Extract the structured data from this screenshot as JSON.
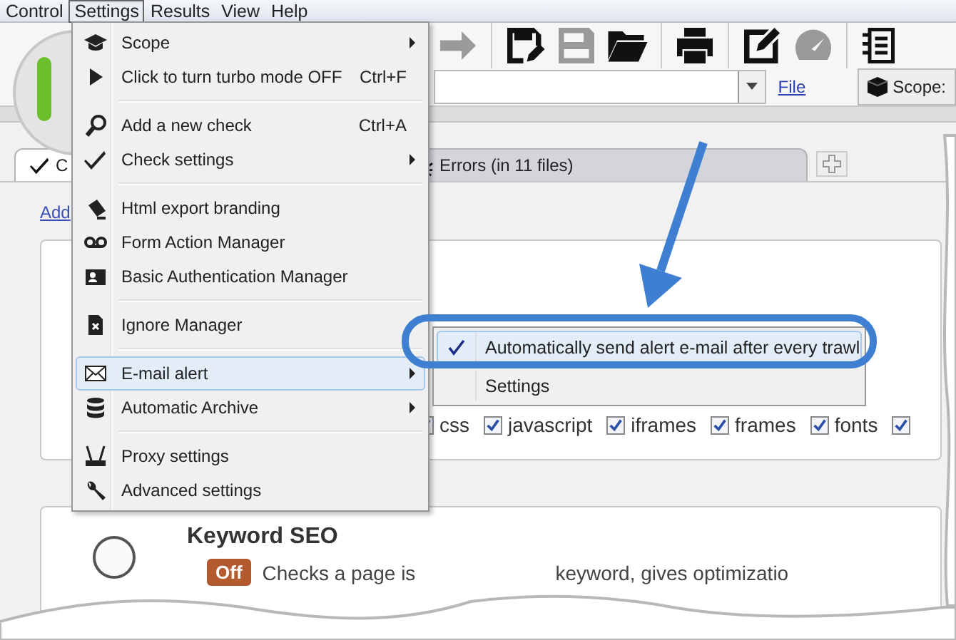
{
  "menu_bar": [
    {
      "label": "Control",
      "selected": false
    },
    {
      "label": "Settings",
      "selected": true
    },
    {
      "label": "Results",
      "selected": false
    },
    {
      "label": "View",
      "selected": false
    },
    {
      "label": "Help",
      "selected": false
    }
  ],
  "toolbar": [
    {
      "kind": "forward",
      "disabled": true
    },
    {
      "kind": "save-edit",
      "disabled": false
    },
    {
      "kind": "save",
      "disabled": true
    },
    {
      "kind": "open",
      "disabled": false
    },
    {
      "kind": "print",
      "disabled": false
    },
    {
      "kind": "edit",
      "disabled": false
    },
    {
      "kind": "gauge",
      "disabled": true
    },
    {
      "kind": "notes",
      "disabled": false
    }
  ],
  "address": {
    "link": "File",
    "scope": "Scope:"
  },
  "tabs": [
    {
      "kind": "check",
      "label": "C",
      "selected": true
    },
    {
      "kind": "errors",
      "label": "Errors (in 11 files)",
      "selected": false
    }
  ],
  "add_link": "Add",
  "filters": [
    {
      "label": "css",
      "checked": true
    },
    {
      "label": "javascript",
      "checked": true
    },
    {
      "label": "iframes",
      "checked": true
    },
    {
      "label": "frames",
      "checked": true
    },
    {
      "label": "fonts",
      "checked": true
    },
    {
      "checked": true
    }
  ],
  "cards": [
    {
      "title": "Keyword SEO",
      "selected": false,
      "badge": "Off",
      "description": [
        "Checks a page is",
        "keyword, gives optimizatio"
      ]
    }
  ],
  "settings_menu": {
    "groups": [
      {
        "items": [
          {
            "label": "Scope",
            "submenu": true,
            "selected": false
          },
          {
            "label": "Click to turn turbo mode OFF",
            "shortcut": "Ctrl+F",
            "submenu": false,
            "selected": false
          }
        ]
      },
      {
        "items": [
          {
            "label": "Add a new check",
            "shortcut": "Ctrl+A",
            "submenu": false,
            "selected": false
          },
          {
            "label": "Check settings",
            "submenu": true,
            "selected": false
          }
        ]
      },
      {
        "items": [
          {
            "label": "Html export branding",
            "submenu": false,
            "selected": false
          },
          {
            "label": "Form Action Manager",
            "submenu": false,
            "selected": false
          },
          {
            "label": "Basic Authentication Manager",
            "submenu": false,
            "selected": false
          }
        ]
      },
      {
        "items": [
          {
            "label": "Ignore Manager",
            "submenu": false,
            "selected": false
          }
        ]
      },
      {
        "items": [
          {
            "label": "E-mail alert",
            "submenu": true,
            "selected": true
          },
          {
            "label": "Automatic Archive",
            "submenu": true,
            "selected": false
          }
        ]
      },
      {
        "items": [
          {
            "label": "Proxy settings",
            "submenu": false,
            "selected": false
          },
          {
            "label": "Advanced settings",
            "submenu": false,
            "selected": false
          }
        ]
      }
    ]
  },
  "submenu": {
    "items": [
      {
        "label": "Automatically send alert e-mail after every trawl",
        "checked": true,
        "selected": true
      },
      {
        "label": "Settings",
        "checked": false,
        "selected": false
      }
    ]
  }
}
